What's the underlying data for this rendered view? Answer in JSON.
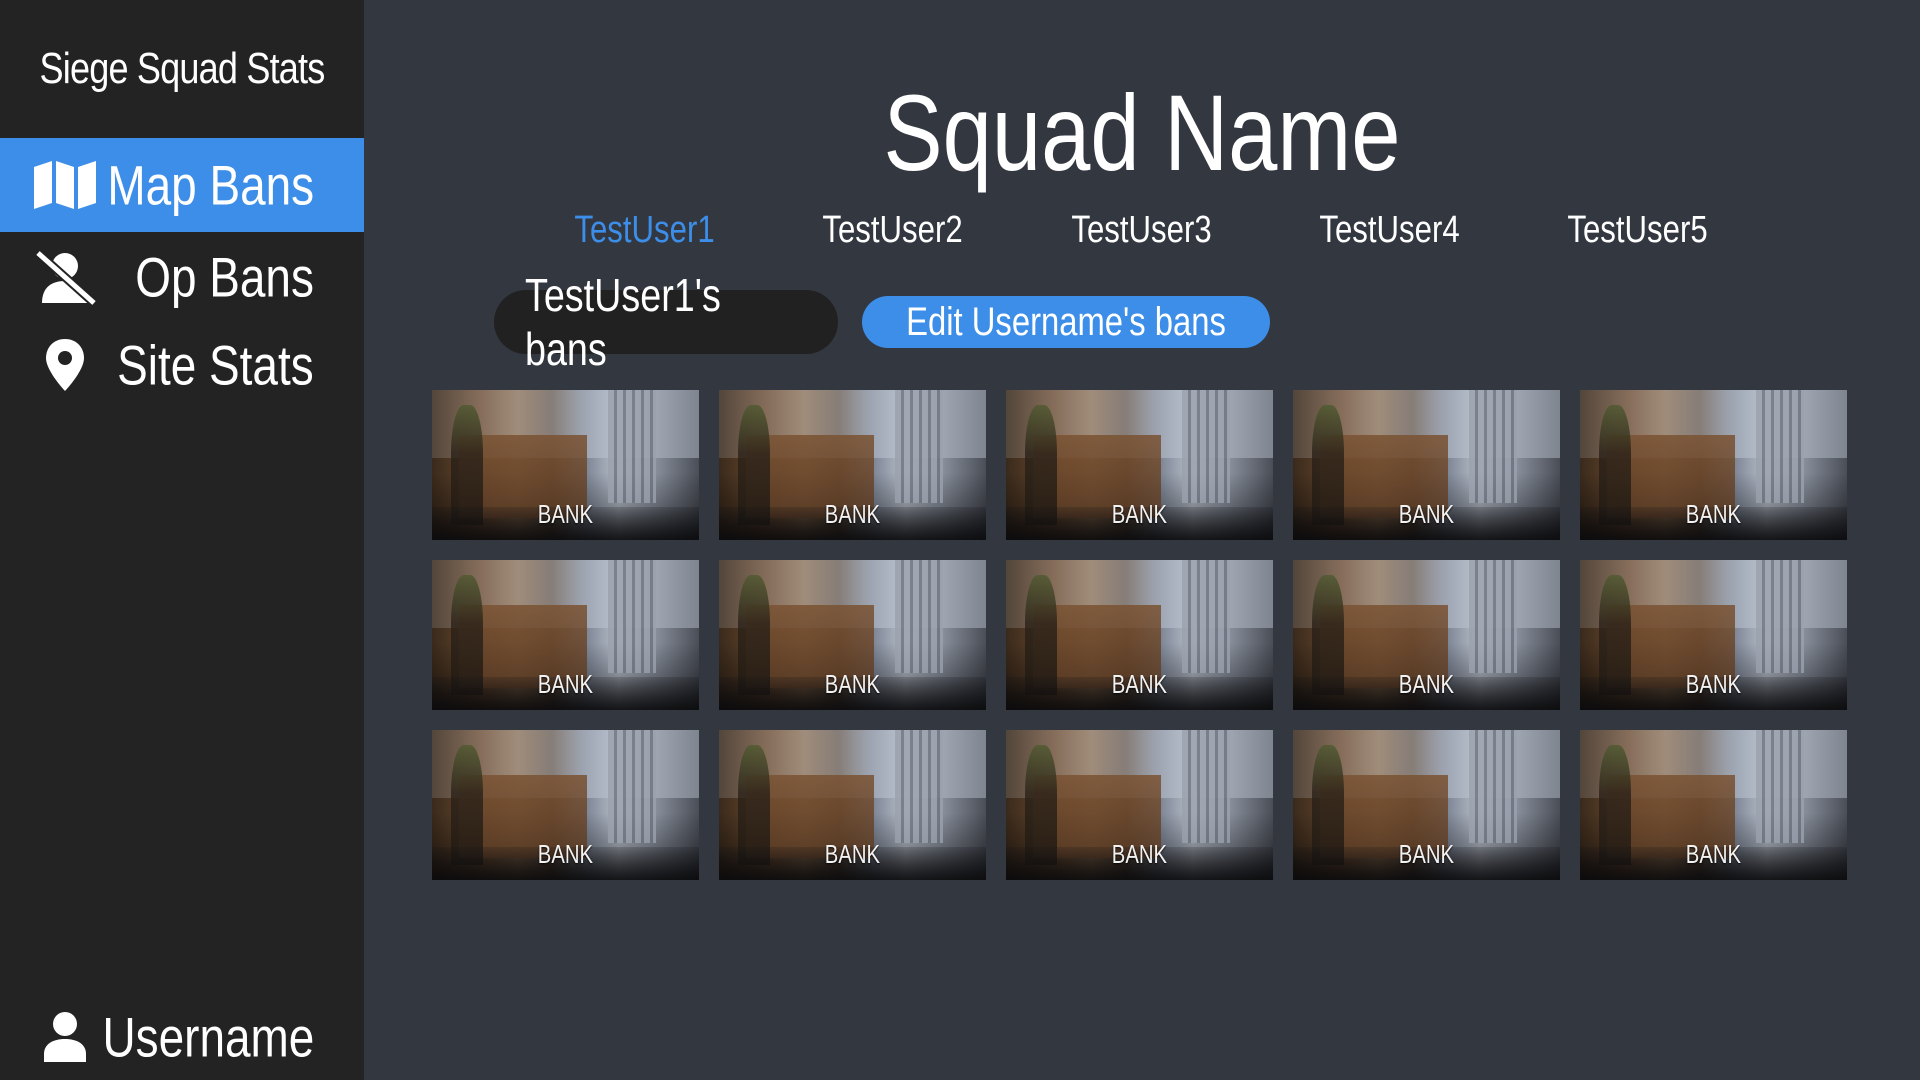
{
  "app": {
    "title": "Siege Squad Stats"
  },
  "sidebar": {
    "items": [
      {
        "label": "Map Bans",
        "icon": "map-icon",
        "active": true
      },
      {
        "label": "Op Bans",
        "icon": "user-slash-icon",
        "active": false
      },
      {
        "label": "Site Stats",
        "icon": "location-pin-icon",
        "active": false
      }
    ],
    "account": {
      "label": "Username",
      "icon": "user-icon"
    }
  },
  "main": {
    "squad_name": "Squad Name",
    "users": [
      {
        "label": "TestUser1",
        "active": true
      },
      {
        "label": "TestUser2",
        "active": false
      },
      {
        "label": "TestUser3",
        "active": false
      },
      {
        "label": "TestUser4",
        "active": false
      },
      {
        "label": "TestUser5",
        "active": false
      }
    ],
    "bans_label": "TestUser1's bans",
    "edit_button": "Edit Username's bans",
    "maps": [
      "BANK",
      "BANK",
      "BANK",
      "BANK",
      "BANK",
      "BANK",
      "BANK",
      "BANK",
      "BANK",
      "BANK",
      "BANK",
      "BANK",
      "BANK",
      "BANK",
      "BANK"
    ]
  },
  "colors": {
    "accent": "#3d8ee8",
    "sidebar_bg": "#232323",
    "main_bg": "#333740",
    "pill_bg": "#212121"
  }
}
